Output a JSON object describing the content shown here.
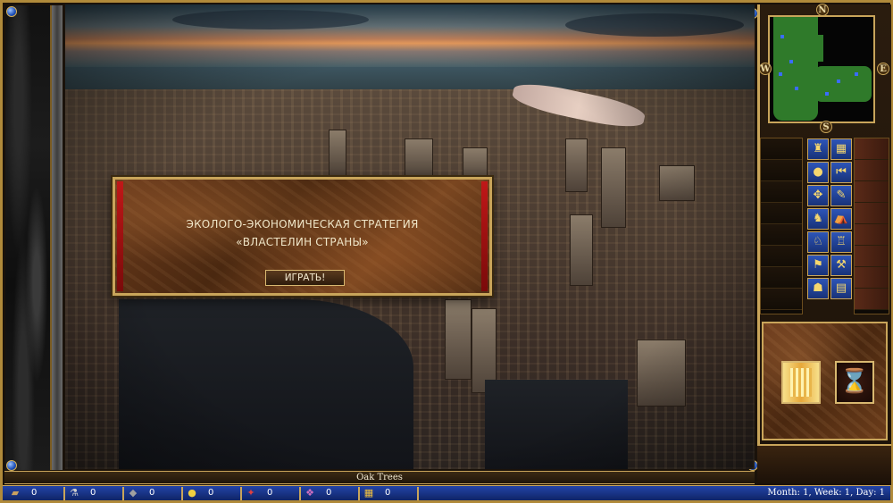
{
  "dialog": {
    "line1": "ЭКОЛОГО-ЭКОНОМИЧЕСКАЯ СТРАТЕГИЯ",
    "line2": "«ВЛАСТЕЛИН СТРАНЫ»",
    "play_label": "ИГРАТЬ!"
  },
  "compass": {
    "n": "N",
    "s": "S",
    "e": "E",
    "w": "W"
  },
  "rollover_text": "Oak Trees",
  "resources": [
    {
      "name": "wood-icon",
      "glyph": "▰",
      "value": "0"
    },
    {
      "name": "mercury-icon",
      "glyph": "⚗",
      "value": "0"
    },
    {
      "name": "ore-icon",
      "glyph": "◆",
      "value": "0"
    },
    {
      "name": "sulfur-icon",
      "glyph": "●",
      "value": "0"
    },
    {
      "name": "crystal-icon",
      "glyph": "✦",
      "value": "0"
    },
    {
      "name": "gems-icon",
      "glyph": "❖",
      "value": "0"
    },
    {
      "name": "gold-icon",
      "glyph": "▦",
      "value": "0"
    }
  ],
  "date_text": "Month: 1, Week: 1, Day: 1",
  "adventure_buttons": [
    {
      "name": "kingdom-overview-button",
      "glyph": "♜"
    },
    {
      "name": "underground-toggle-button",
      "glyph": "▦"
    },
    {
      "name": "view-world-button",
      "glyph": "●"
    },
    {
      "name": "sleep-hero-button",
      "glyph": "⏮"
    },
    {
      "name": "quest-log-button",
      "glyph": "✥"
    },
    {
      "name": "cast-spell-button",
      "glyph": "✎"
    },
    {
      "name": "move-hero-button",
      "glyph": "♞"
    },
    {
      "name": "adventure-options-button",
      "glyph": "⛺"
    },
    {
      "name": "next-hero-button",
      "glyph": "♘"
    },
    {
      "name": "system-options-button",
      "glyph": "♖"
    },
    {
      "name": "end-turn-button",
      "glyph": "⚑"
    },
    {
      "name": "end-turn-2-button",
      "glyph": "⚒"
    },
    {
      "name": "puzzle-map-button",
      "glyph": "☗"
    },
    {
      "name": "scenario-info-button",
      "glyph": "▤"
    }
  ],
  "colors": {
    "gold_border": "#c9a55a",
    "blue_bar": "#1a3890",
    "dialog_red": "#c01818"
  }
}
